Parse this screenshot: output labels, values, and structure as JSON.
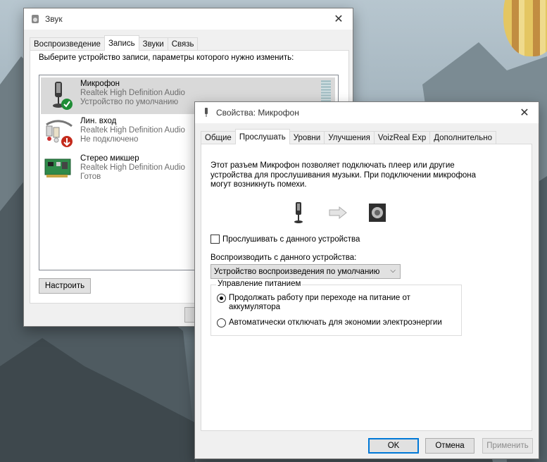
{
  "sound_window": {
    "title": "Звук",
    "tabs": [
      "Воспроизведение",
      "Запись",
      "Звуки",
      "Связь"
    ],
    "active_tab": 1,
    "instruction": "Выберите устройство записи, параметры которого нужно изменить:",
    "devices": [
      {
        "name": "Микрофон",
        "driver": "Realtek High Definition Audio",
        "status": "Устройство по умолчанию",
        "status_badge": "check-icon"
      },
      {
        "name": "Лин. вход",
        "driver": "Realtek High Definition Audio",
        "status": "Не подключено",
        "status_badge": "down-arrow-icon"
      },
      {
        "name": "Стерео микшер",
        "driver": "Realtek High Definition Audio",
        "status": "Готов",
        "status_badge": ""
      }
    ],
    "configure_button": "Настроить"
  },
  "props_window": {
    "title": "Свойства: Микрофон",
    "tabs": [
      "Общие",
      "Прослушать",
      "Уровни",
      "Улучшения",
      "VoizReal Exp",
      "Дополнительно"
    ],
    "active_tab": 1,
    "description": "Этот разъем Микрофон позволяет подключать плеер или другие устройства для прослушивания музыки. При подключении микрофона могут возникнуть помехи.",
    "listen_checkbox": {
      "label": "Прослушивать с данного устройства",
      "checked": false
    },
    "playback_label": "Воспроизводить с данного устройства:",
    "playback_select": "Устройство воспроизведения по умолчанию",
    "power_group": {
      "legend": "Управление питанием",
      "options": [
        {
          "label": "Продолжать работу при переходе на питание от аккумулятора",
          "selected": true
        },
        {
          "label": "Автоматически отключать для экономии электроэнергии",
          "selected": false
        }
      ]
    },
    "buttons": {
      "ok": "OK",
      "cancel": "Отмена",
      "apply": "Применить"
    }
  },
  "colors": {
    "accent": "#0078d7",
    "check_green": "#1e8c35",
    "arrow_red": "#c42b1c"
  }
}
